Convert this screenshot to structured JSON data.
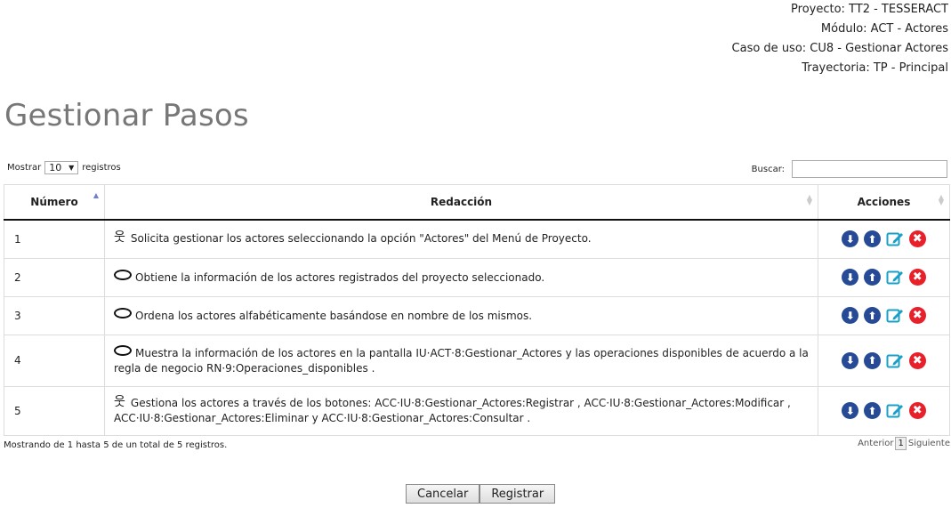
{
  "context": {
    "proyecto": "Proyecto: TT2 - TESSERACT",
    "modulo": "Módulo: ACT - Actores",
    "caso": "Caso de uso: CU8 - Gestionar Actores",
    "trayectoria": "Trayectoria: TP - Principal"
  },
  "page_title": "Gestionar Pasos",
  "length_menu": {
    "prefix": "Mostrar",
    "value": "10",
    "suffix": "registros"
  },
  "search": {
    "label": "Buscar:",
    "value": ""
  },
  "table": {
    "headers": {
      "numero": "Número",
      "redaccion": "Redacción",
      "acciones": "Acciones"
    },
    "rows": [
      {
        "numero": "1",
        "actor": "actor",
        "text": "Solicita gestionar los actores seleccionando la opción \"Actores\" del Menú de Proyecto."
      },
      {
        "numero": "2",
        "actor": "system",
        "text": "Obtiene la información de los actores registrados del proyecto seleccionado."
      },
      {
        "numero": "3",
        "actor": "system",
        "text": "Ordena los actores alfabéticamente basándose en nombre de los mismos."
      },
      {
        "numero": "4",
        "actor": "system",
        "text": "Muestra la información de los actores en la pantalla IU·ACT·8:Gestionar_Actores y las operaciones disponibles de acuerdo a la regla de negocio RN·9:Operaciones_disponibles ."
      },
      {
        "numero": "5",
        "actor": "actor",
        "text": "Gestiona los actores a través de los botones: ACC·IU·8:Gestionar_Actores:Registrar , ACC·IU·8:Gestionar_Actores:Modificar , ACC·IU·8:Gestionar_Actores:Eliminar y ACC·IU·8:Gestionar_Actores:Consultar ."
      }
    ]
  },
  "icons": {
    "actor": "stick-figure-icon",
    "system": "ellipse-icon",
    "down": "arrow-down-circle-icon",
    "up": "arrow-up-circle-icon",
    "edit": "edit-icon",
    "delete": "delete-icon"
  },
  "colors": {
    "action_blue": "#264a96",
    "edit_teal": "#1aa0c8",
    "delete_red": "#e8202a",
    "sort_active": "#6f7fd8"
  },
  "info": "Mostrando de 1 hasta 5 de un total de 5 registros.",
  "pagination": {
    "previous": "Anterior",
    "current": "1",
    "next": "Siguiente"
  },
  "buttons": {
    "cancel": "Cancelar",
    "register": "Registrar"
  }
}
